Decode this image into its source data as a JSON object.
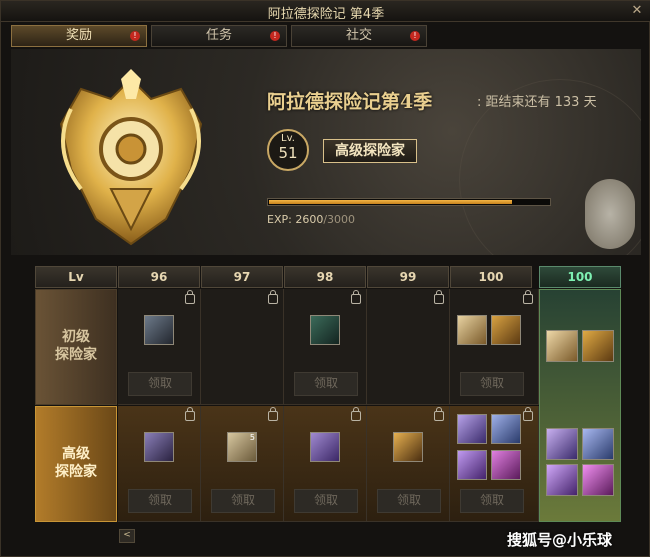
{
  "window": {
    "title": "阿拉德探险记 第4季",
    "close_glyph": "✕"
  },
  "tabs": [
    {
      "label": "奖励",
      "active": true,
      "badge": "!"
    },
    {
      "label": "任务",
      "active": false,
      "badge": "!"
    },
    {
      "label": "社交",
      "active": false,
      "badge": "!"
    }
  ],
  "season": {
    "title": "阿拉德探险记第4季",
    "remaining": ":  距结束还有 133 天",
    "level_prefix": "Lv.",
    "level": "51",
    "rank": "高级探险家",
    "exp_label": "EXP:",
    "exp_current": "2600",
    "exp_max": "/3000",
    "exp_fraction": 0.867
  },
  "grid": {
    "lv_header": "Lv",
    "levels": [
      "96",
      "97",
      "98",
      "99",
      "100"
    ],
    "bonus_level": "100",
    "row1_label_a": "初级",
    "row1_label_b": "探险家",
    "row2_label_a": "高级",
    "row2_label_b": "探险家",
    "claim_label": "领取",
    "item_count_97": "5"
  },
  "nav": {
    "scroll_left": "<"
  },
  "watermark": "搜狐号@小乐球",
  "colors": {
    "accent_gold": "#e9cf8f",
    "exp_fill": "#f3b646",
    "bonus_green": "#7ef0b2",
    "badge_red": "#c4281f"
  }
}
